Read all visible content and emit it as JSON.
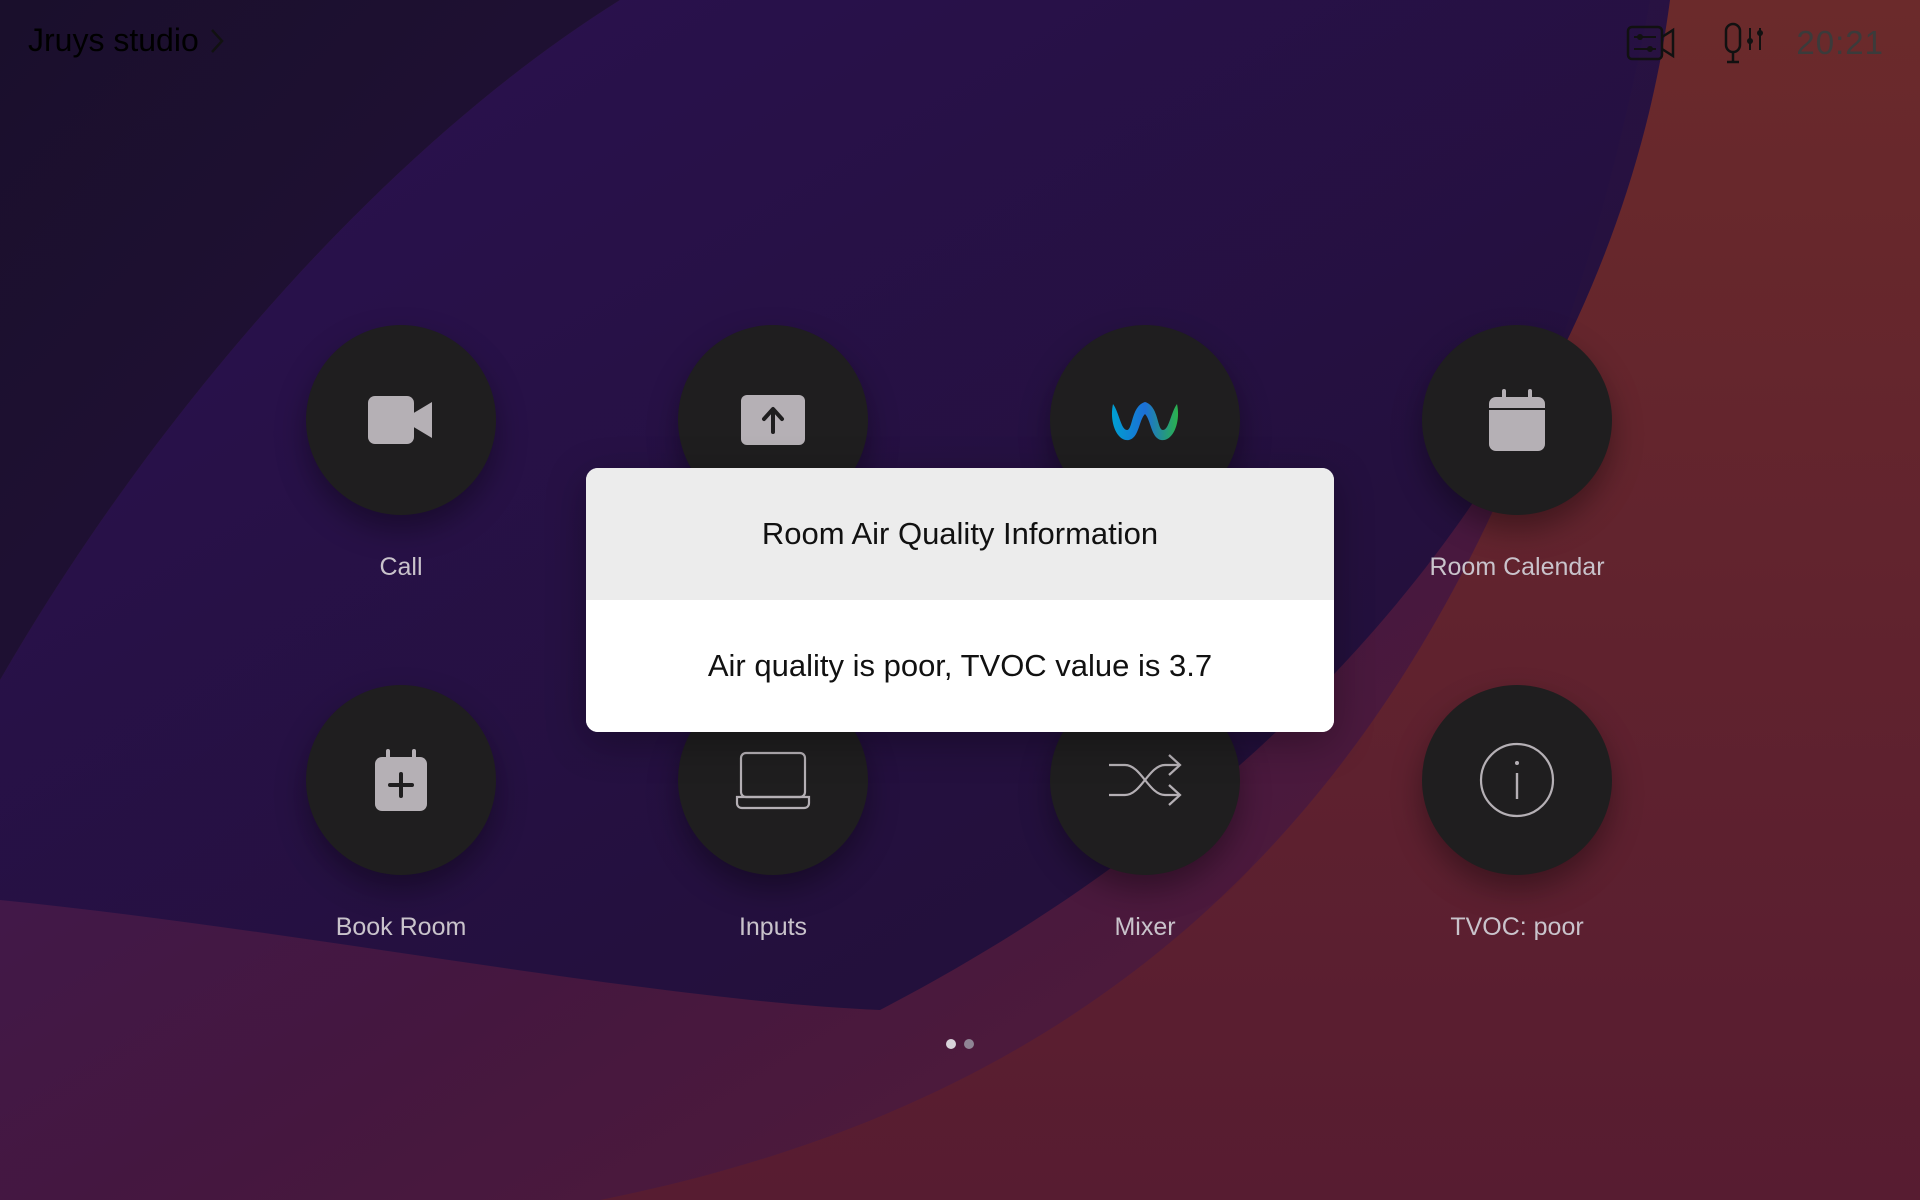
{
  "header": {
    "room_name": "Jruys studio",
    "time": "20:21",
    "icons": [
      "camera-settings-icon",
      "microphone-settings-icon"
    ]
  },
  "tiles": [
    {
      "label": "Call",
      "icon": "video-camera-icon"
    },
    {
      "label": "",
      "icon": "share-screen-icon"
    },
    {
      "label": "",
      "icon": "webex-logo-icon"
    },
    {
      "label": "Room Calendar",
      "icon": "calendar-icon"
    },
    {
      "label": "Book Room",
      "icon": "calendar-add-icon"
    },
    {
      "label": "Inputs",
      "icon": "laptop-icon"
    },
    {
      "label": "Mixer",
      "icon": "shuffle-icon"
    },
    {
      "label": "TVOC: poor",
      "icon": "info-icon"
    }
  ],
  "dialog": {
    "title": "Room Air Quality Information",
    "message": "Air quality is poor, TVOC value is 3.7"
  },
  "pager": {
    "pages": 2,
    "current": 1
  },
  "colors": {
    "tile": "#1f1e1f",
    "bg_purple": "#2a1145",
    "bg_red": "#5e2430"
  }
}
